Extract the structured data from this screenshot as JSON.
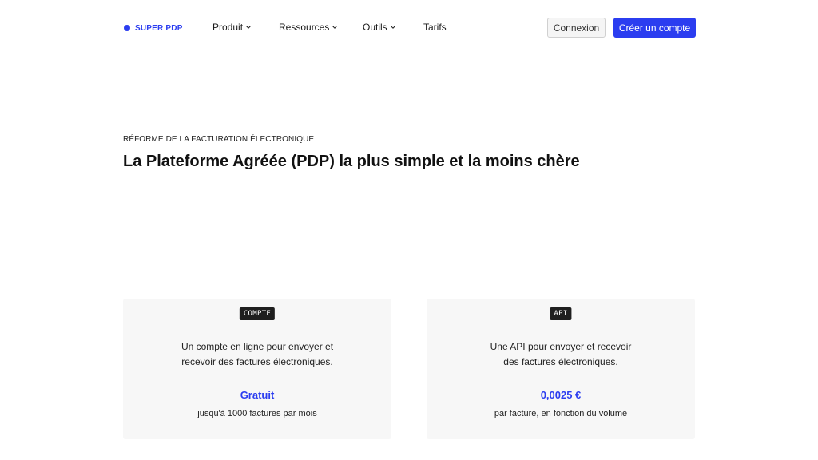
{
  "header": {
    "logo": "SUPER PDP",
    "nav": [
      {
        "label": "Produit",
        "dropdown": true
      },
      {
        "label": "Ressources",
        "dropdown": true
      },
      {
        "label": "Outils",
        "dropdown": true
      },
      {
        "label": "Tarifs",
        "dropdown": false
      }
    ],
    "login_label": "Connexion",
    "signup_label": "Créer un compte"
  },
  "hero": {
    "eyebrow": "RÉFORME DE LA FACTURATION ÉLECTRONIQUE",
    "title": "La Plateforme Agréée (PDP) la plus simple et la moins chère"
  },
  "cards": [
    {
      "tag": "COMPTE",
      "desc_line1": "Un compte en ligne pour envoyer et",
      "desc_line2": "recevoir des factures électroniques.",
      "price": "Gratuit",
      "price_sub": "jusqu'à 1000 factures par mois"
    },
    {
      "tag": "API",
      "desc_line1": "Une API pour envoyer et recevoir",
      "desc_line2": "des factures électroniques.",
      "price": "0,0025 €",
      "price_sub": "par facture, en fonction du volume"
    }
  ],
  "colors": {
    "accent": "#2b3df0",
    "card_bg": "#f7f7f7",
    "tag_bg": "#1f1f1f"
  }
}
